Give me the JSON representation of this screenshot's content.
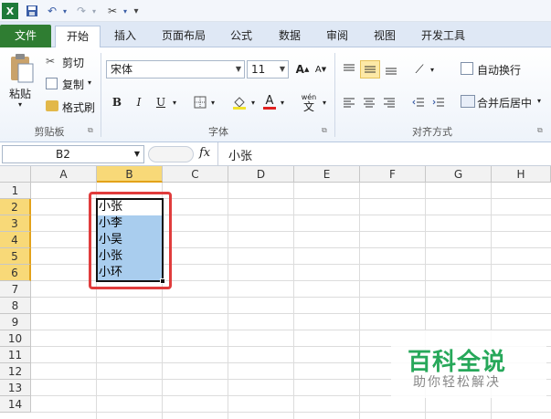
{
  "quick_access": {
    "menu_arrow": "▾"
  },
  "tabs": [
    {
      "label": "文件"
    },
    {
      "label": "开始"
    },
    {
      "label": "插入"
    },
    {
      "label": "页面布局"
    },
    {
      "label": "公式"
    },
    {
      "label": "数据"
    },
    {
      "label": "审阅"
    },
    {
      "label": "视图"
    },
    {
      "label": "开发工具"
    }
  ],
  "clipboard": {
    "paste": "粘贴",
    "cut": "剪切",
    "copy": "复制",
    "format_painter": "格式刷",
    "group": "剪贴板"
  },
  "font": {
    "name": "宋体",
    "size": "11",
    "bold": "B",
    "italic": "I",
    "underline": "U",
    "group": "字体",
    "wen": "wén",
    "wen_char": "文"
  },
  "alignment": {
    "wrap": "自动换行",
    "merge": "合并后居中",
    "group": "对齐方式"
  },
  "formula_bar": {
    "name_box": "B2",
    "fx": "fx",
    "value": "小张"
  },
  "columns": [
    "A",
    "B",
    "C",
    "D",
    "E",
    "F",
    "G",
    "H"
  ],
  "rows": [
    "1",
    "2",
    "3",
    "4",
    "5",
    "6",
    "7",
    "8",
    "9",
    "10",
    "11",
    "12",
    "13",
    "14"
  ],
  "cells": [
    {
      "ref": "B2",
      "value": "小张"
    },
    {
      "ref": "B3",
      "value": "小李"
    },
    {
      "ref": "B4",
      "value": "小吴"
    },
    {
      "ref": "B5",
      "value": "小张"
    },
    {
      "ref": "B6",
      "value": "小环"
    }
  ],
  "watermark": {
    "title": "百科全说",
    "subtitle": "助你轻松解决"
  },
  "colors": {
    "file_tab": "#2f7d32",
    "selection_fill": "#a9cdee",
    "highlight_box": "#e03c3c",
    "header_selected": "#f8d978"
  }
}
